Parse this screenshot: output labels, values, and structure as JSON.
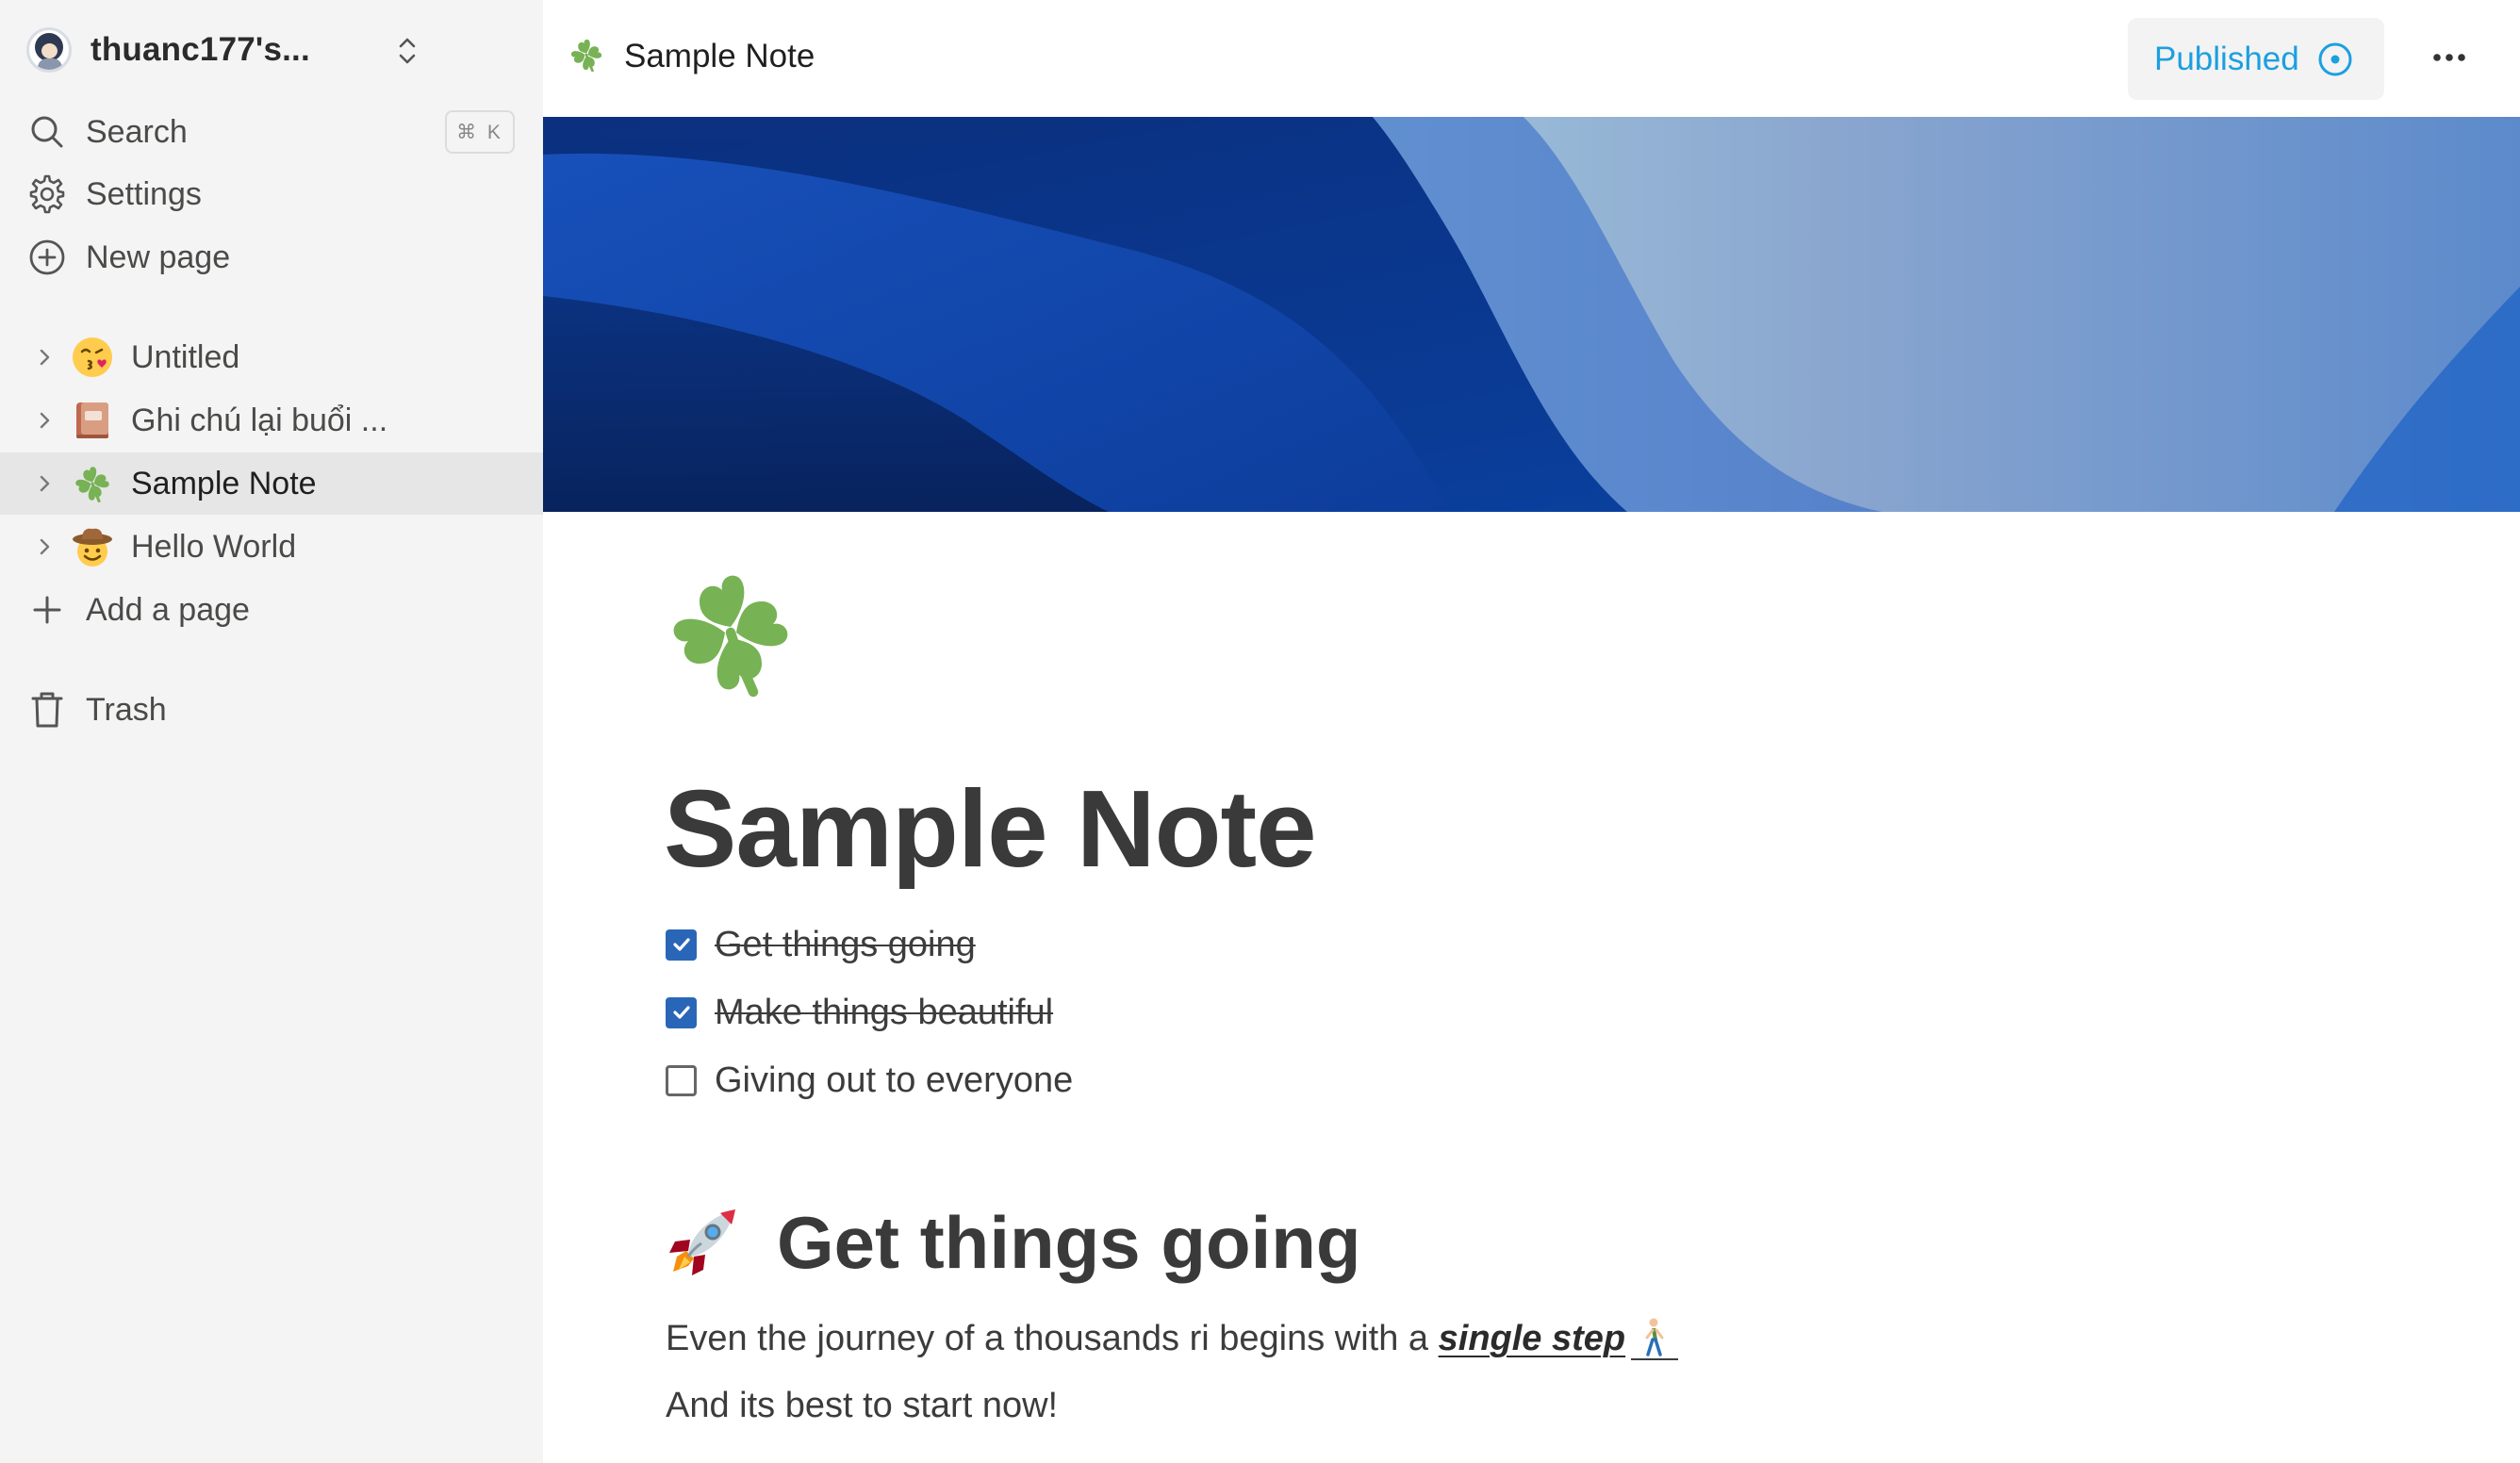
{
  "workspace": {
    "name": "thuanc177's..."
  },
  "nav": {
    "search": {
      "label": "Search",
      "shortcut": "⌘ K"
    },
    "settings": {
      "label": "Settings"
    },
    "new_page": {
      "label": "New page"
    }
  },
  "pages": [
    {
      "label": "Untitled",
      "emoji": "kissing-face-emoji",
      "active": false
    },
    {
      "label": "Ghi chú lại buổi ...",
      "emoji": "notebook-emoji",
      "active": false
    },
    {
      "label": "Sample Note",
      "emoji": "four-leaf-clover-emoji",
      "active": true
    },
    {
      "label": "Hello World",
      "emoji": "cowboy-face-emoji",
      "active": false
    }
  ],
  "add_page": {
    "label": "Add a page"
  },
  "trash": {
    "label": "Trash"
  },
  "topbar": {
    "title": "Sample Note",
    "publish_label": "Published"
  },
  "document": {
    "title": "Sample Note",
    "icon": "four-leaf-clover-emoji",
    "todos": [
      {
        "text": "Get things going",
        "checked": true
      },
      {
        "text": "Make things beautiful",
        "checked": true
      },
      {
        "text": "Giving out to everyone",
        "checked": false
      }
    ],
    "heading": {
      "emoji": "rocket-emoji",
      "text": "Get things going"
    },
    "paragraph1": {
      "prefix": "Even the journey of a thousands ri begins with a ",
      "emphasis": "single step",
      "trail_emoji": "person-walking-emoji"
    },
    "paragraph2": "And its best to start now!"
  },
  "colors": {
    "sidebar_bg": "#f4f4f4",
    "active_item_bg": "#e6e6e6",
    "accent_blue": "#1b9fe0",
    "checkbox_blue": "#2a66b8",
    "text": "#3a3a3a"
  }
}
